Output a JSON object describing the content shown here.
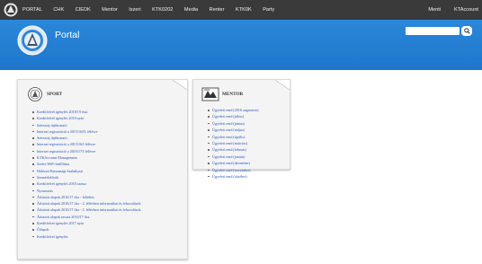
{
  "topnav": {
    "items": [
      "PORTAL",
      "CHK",
      "CIEDK",
      "Mentor",
      "Iszeri",
      "KTK0202",
      "Media",
      "Renter",
      "KTK0K",
      "Party"
    ],
    "right_items": [
      "Menti",
      "KTAccount"
    ]
  },
  "header": {
    "title": "Portal",
    "search_placeholder": ""
  },
  "sport": {
    "title": "SPORT",
    "links": [
      "Kreditfelvét igénylés 2018/19 őszi",
      "Kreditfelvét igénylés 2018 nyár",
      "Sziesztaj tájékoztató",
      "Internet regisztráció a 2015/16/II. félévre",
      "Sziesztaj tájékoztató",
      "Internet regisztráció a 2015/16/I félévre",
      "Internet regisztráció a 2016/17/I félévre",
      "KTKAccount Management",
      "Szeles WiFi beállítása",
      "Hálózati Biztonsági Szabályzat",
      "Szemfelelősök",
      "Kreditfelvét igénylés 2018 tavasz",
      "Nyomtatás",
      "Átfuttott alapok 2016/17 tlsz - feltöltés",
      "Átfuttott alapok 2016/17 tlsz - 2. félévben informatikai és felsorolások",
      "Átfuttott alapok 2016/17 tlsz - 2. félévben informatikai és felsorolások",
      "Átfuttott alapok tavasz 2016/17 tlsz",
      "Kreditfelvét igénylés 2017 nyár",
      "Űrlapok",
      "Kreditfelvét igénylés"
    ]
  },
  "mentor": {
    "title": "MENTOR",
    "links": [
      "Ügyeleti rend (2016 augusztus)",
      "Ügyeleti rend (július)",
      "Ügyeleti rend (június)",
      "Ügyeleti rend (május)",
      "Ügyeleti rend (április)",
      "Ügyeleti rend (március)",
      "Ügyeleti rend (február)",
      "Ügyeleti rend (január)",
      "Ügyeleti rend (december)",
      "Ügyeleti rend (november)",
      "Ügyeleti rend (október)"
    ]
  },
  "colors": {
    "topbar": "#3a3a3a",
    "header": "#2b87da",
    "link": "#2a55b8"
  }
}
